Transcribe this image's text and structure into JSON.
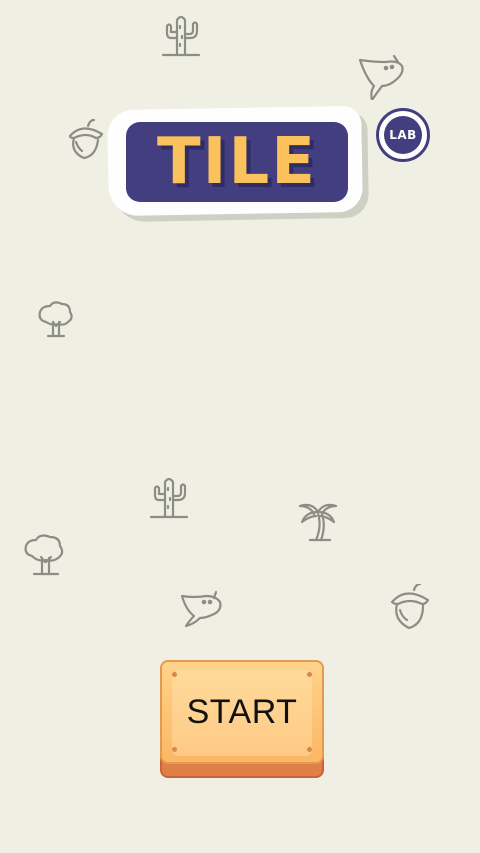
{
  "game": {
    "logo_title": "TILE",
    "logo_badge": "LAB",
    "start_label": "START"
  },
  "colors": {
    "background": "#eff0e3",
    "logo_plate": "#423e80",
    "logo_letters": "#fbc15c",
    "button_face": "#fcb765",
    "button_base": "#e07f45"
  },
  "decorations": [
    "cactus-icon",
    "stingray-icon",
    "acorn-icon",
    "tree-icon",
    "cactus-icon",
    "palm-tree-icon",
    "tree-icon",
    "stingray-icon",
    "acorn-icon"
  ]
}
